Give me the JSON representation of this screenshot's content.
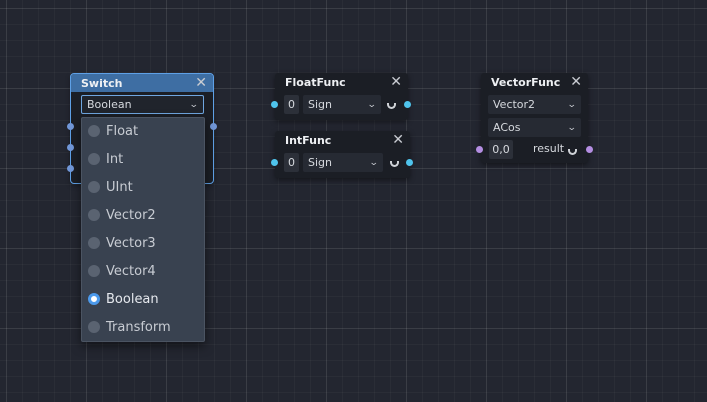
{
  "switch_node": {
    "title": "Switch",
    "close_glyph": "✕",
    "selected_value": "Boolean",
    "options": [
      {
        "label": "Float",
        "checked": false
      },
      {
        "label": "Int",
        "checked": false
      },
      {
        "label": "UInt",
        "checked": false
      },
      {
        "label": "Vector2",
        "checked": false
      },
      {
        "label": "Vector3",
        "checked": false
      },
      {
        "label": "Vector4",
        "checked": false
      },
      {
        "label": "Boolean",
        "checked": true
      },
      {
        "label": "Transform",
        "checked": false
      }
    ]
  },
  "float_func": {
    "title": "FloatFunc",
    "close_glyph": "✕",
    "input_value": "0",
    "function": "Sign"
  },
  "int_func": {
    "title": "IntFunc",
    "close_glyph": "✕",
    "input_value": "0",
    "function": "Sign"
  },
  "vector_func": {
    "title": "VectorFunc",
    "close_glyph": "✕",
    "type": "Vector2",
    "function": "ACos",
    "input_value": "0,0",
    "output_label": "result"
  },
  "icons": {
    "dropdown": "chevron-down-icon",
    "close": "close-icon",
    "spinner": "loading-spinner-icon"
  },
  "colors": {
    "canvas": "#232630",
    "node": "#1b1e25",
    "selected_header": "#3e6ea3",
    "port_float": "#4fc4ec",
    "port_bool": "#7197d8",
    "port_vector": "#b48ee2",
    "radio_checked": "#4c9aec"
  }
}
